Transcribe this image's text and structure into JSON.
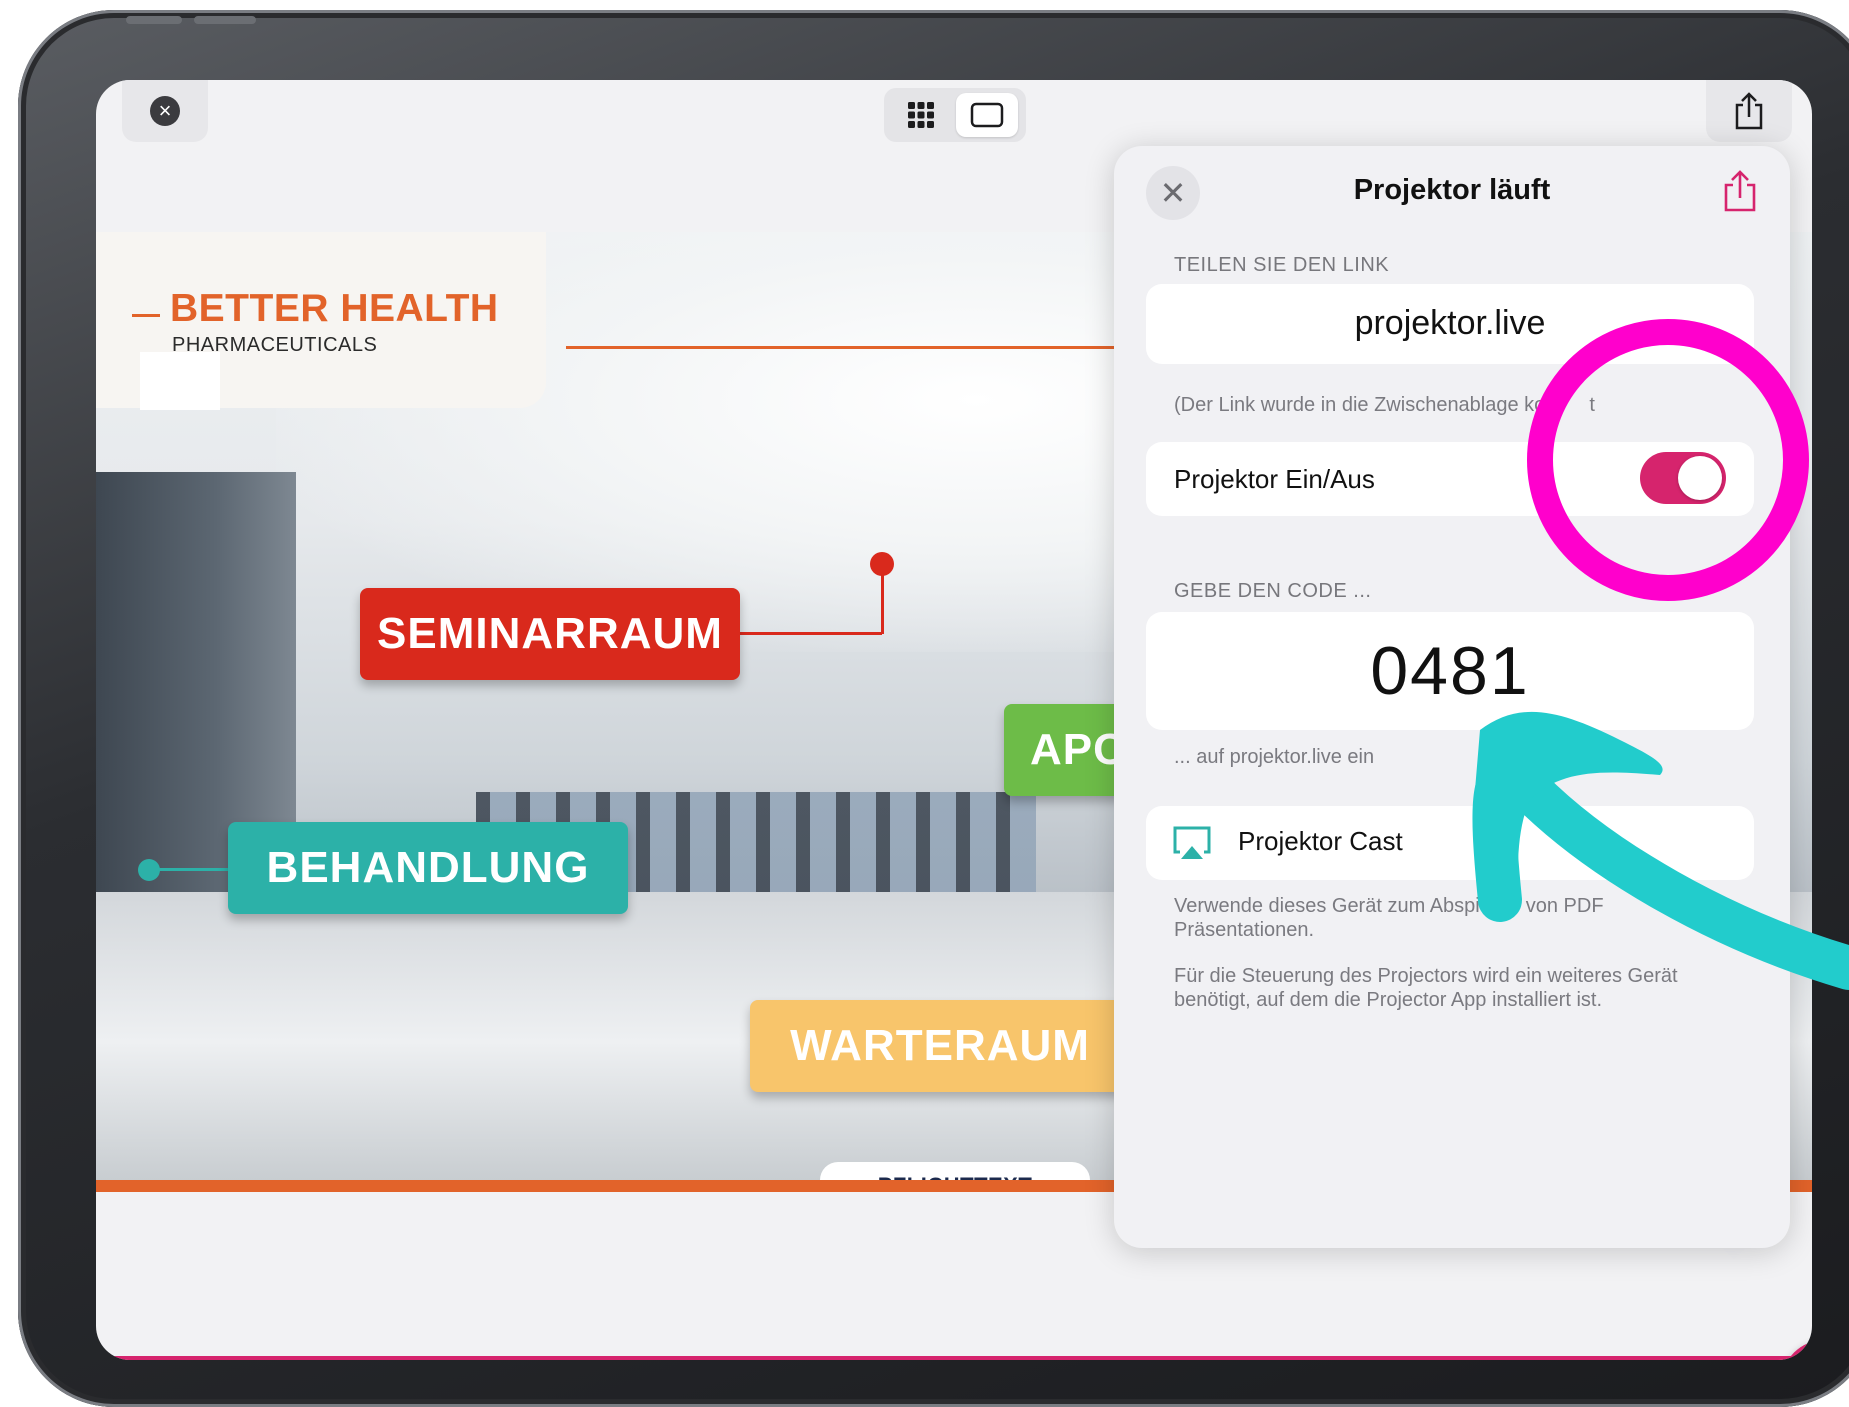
{
  "slide": {
    "logo_title": "BETTER HEALTH",
    "logo_subtitle": "PHARMACEUTICALS",
    "tags": {
      "seminar": "SEMINARRAUM",
      "behandlung": "BEHANDLUNG",
      "apotheke_partial": "APC",
      "warteraum": "WARTERAUM"
    },
    "pflichttext": "PFLICHTTEXT"
  },
  "toolbar": {
    "close_icon": "close-icon",
    "grid_icon": "grid-icon",
    "single_icon": "single-page-icon",
    "share_icon": "share-icon"
  },
  "popover": {
    "title": "Projektor läuft",
    "share_section_label": "TEILEN SIE DEN LINK",
    "link": "projektor.live",
    "link_note": "(Der Link wurde in die Zwischenablage ko",
    "link_note_tail": "t",
    "toggle_label": "Projektor Ein/Aus",
    "toggle_on": true,
    "code_section_label": "GEBE DEN CODE ...",
    "code": "0481",
    "code_note": "... auf projektor.live ein",
    "cast_label": "Projektor Cast",
    "cast_desc_a": "Verwende dieses Gerät zum Abspi",
    "cast_desc_b": "von PDF",
    "cast_desc_c": "Präsentationen.",
    "cast_note": "Für die Steuerung des Projectors wird ein weiteres Gerät benötigt, auf dem die Projector App installiert ist."
  },
  "colors": {
    "accent": "#d6246d",
    "annotation_circle": "#ff00cc",
    "annotation_arrow": "#22cccc",
    "brand_orange": "#e2632a"
  }
}
